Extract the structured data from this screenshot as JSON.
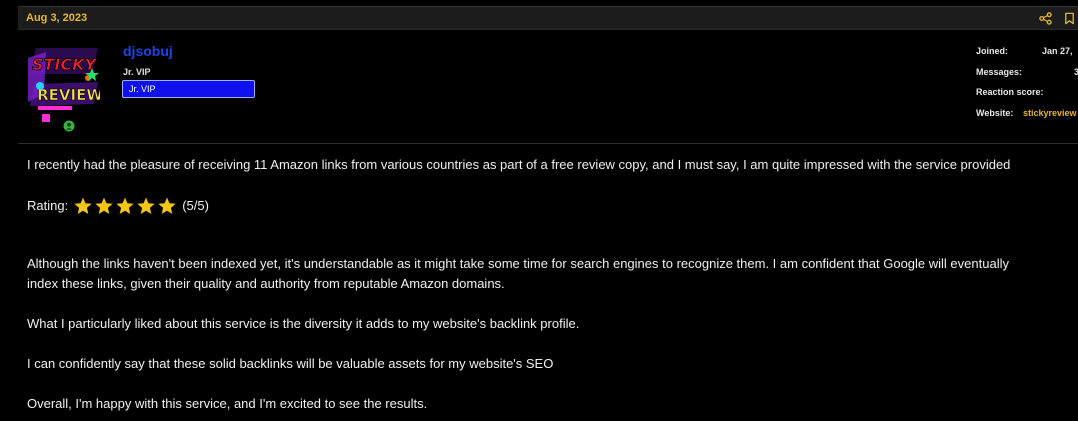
{
  "post": {
    "date": "Aug 3, 2023"
  },
  "user": {
    "name": "djsobuj",
    "title": "Jr. VIP",
    "banner": "Jr. VIP",
    "avatar_text_top": "STICKY",
    "avatar_text_bottom": "REVIEW"
  },
  "stats": {
    "joined_label": "Joined:",
    "joined_value": "Jan 27,",
    "messages_label": "Messages:",
    "messages_value": "3",
    "reaction_label": "Reaction score:",
    "reaction_value": "",
    "website_label": "Website:",
    "website_value": "stickyreview"
  },
  "message": {
    "p1": "I recently had the pleasure of receiving 11 Amazon links from various countries as part of a free review copy, and I must say, I am quite impressed with the service provided",
    "rating_label": "Rating:",
    "rating_stars": 5,
    "rating_text": "(5/5)",
    "p2_line1": "Although the links haven't been indexed yet, it's understandable as it might take some time for search engines to recognize them. I am confident that Google will eventually",
    "p2_line2": "index these links, given their quality and authority from reputable Amazon domains.",
    "p3": "What I particularly liked about this service is the diversity it adds to my website's backlink profile.",
    "p4": "I can confidently say that these solid backlinks will be valuable assets for my website's SEO",
    "p5": "Overall, I'm happy with this service, and I'm excited to see the results."
  },
  "colors": {
    "date": "#e6b830",
    "username": "#1e44e8",
    "banner_bg": "#1010ee",
    "star": "#f5c518",
    "online": "#3cb043"
  },
  "icons": [
    "share-icon",
    "bookmark-icon",
    "online-status-icon",
    "star-icon"
  ]
}
